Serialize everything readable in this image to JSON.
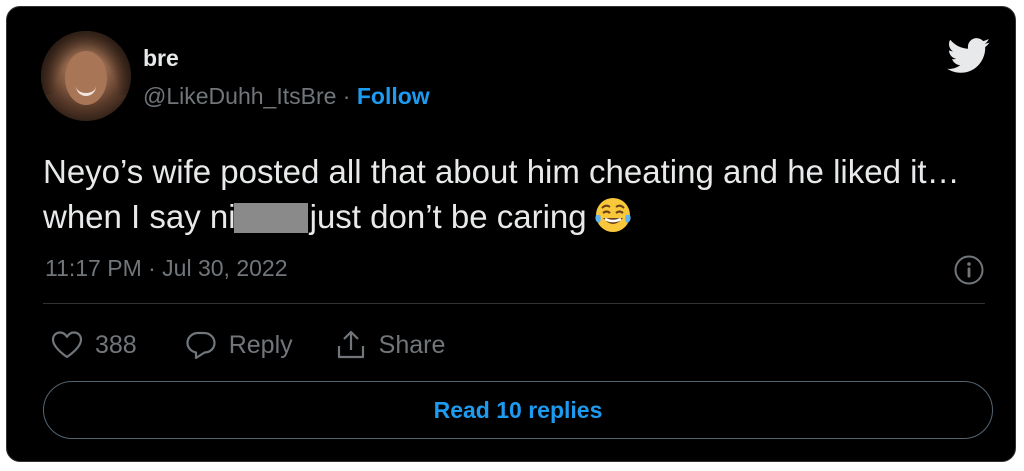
{
  "author": {
    "name": "bre",
    "handle": "@LikeDuhh_ItsBre",
    "separator": " · ",
    "follow_label": "Follow"
  },
  "tweet": {
    "text_before_redaction": "Neyo’s wife posted all that about him cheating and he liked it… when I say ni",
    "text_after_redaction": "just don’t be caring",
    "emoji": "face-with-tears-of-joy-icon",
    "timestamp": "11:17 PM · Jul 30, 2022"
  },
  "actions": {
    "like_count": "388",
    "reply_label": "Reply",
    "share_label": "Share"
  },
  "read_replies_label": "Read 10 replies",
  "colors": {
    "background": "#000000",
    "text": "#e7e9ea",
    "secondary": "#71767b",
    "accent": "#1d9bf0",
    "border": "#2f3336"
  }
}
